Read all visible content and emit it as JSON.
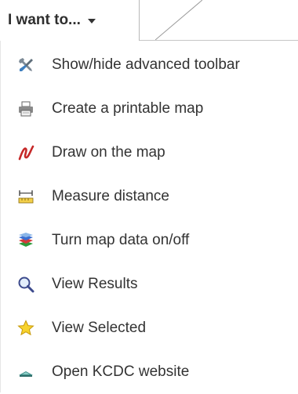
{
  "dropdown": {
    "label": "I want to..."
  },
  "menu": {
    "items": [
      {
        "label": "Show/hide advanced toolbar",
        "icon": "tools-icon"
      },
      {
        "label": "Create a printable map",
        "icon": "printer-icon"
      },
      {
        "label": "Draw on the map",
        "icon": "draw-icon"
      },
      {
        "label": "Measure distance",
        "icon": "measure-icon"
      },
      {
        "label": "Turn map data on/off",
        "icon": "layers-icon"
      },
      {
        "label": "View Results",
        "icon": "magnifier-icon"
      },
      {
        "label": "View Selected",
        "icon": "star-icon"
      },
      {
        "label": "Open KCDC website",
        "icon": "website-icon"
      }
    ]
  }
}
